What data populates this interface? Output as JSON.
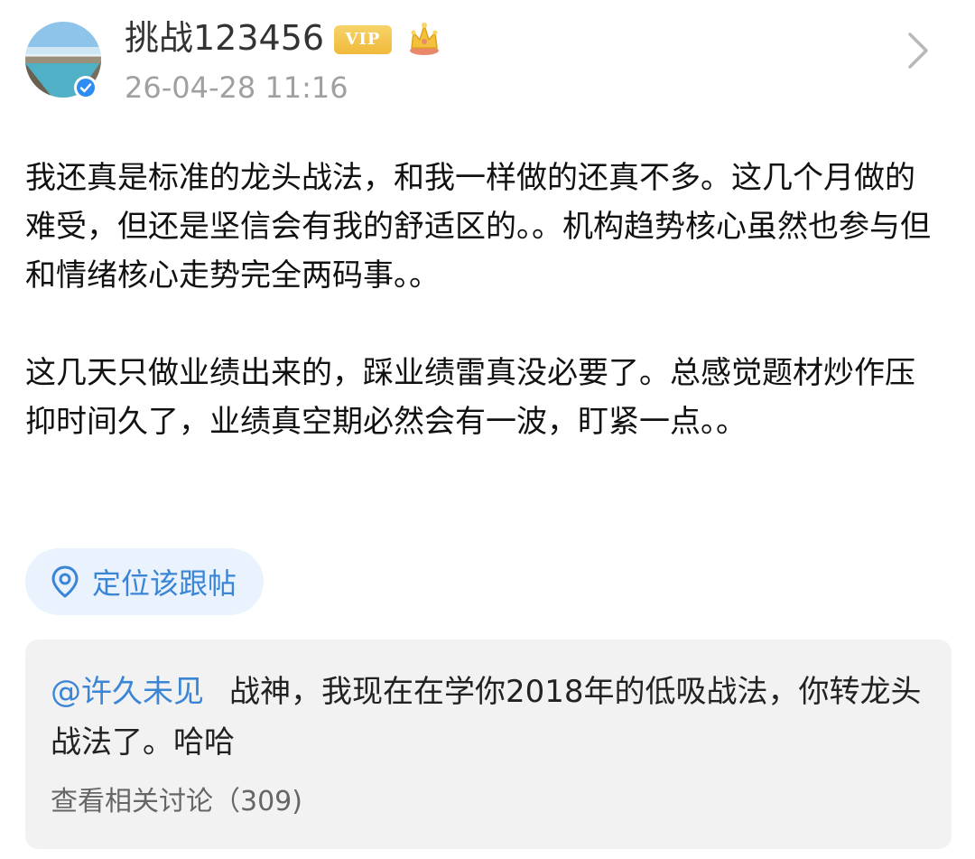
{
  "post": {
    "author": {
      "username": "挑战123456",
      "vip_label": "VIP",
      "avatar_icon": "lake-landscape-avatar",
      "verified_icon": "verified-check-icon",
      "crown_icon": "crown-icon"
    },
    "timestamp": "26-04-28 11:16",
    "body": {
      "paragraph_1": "我还真是标准的龙头战法，和我一样做的还真不多。这几个月做的难受，但还是坚信会有我的舒适区的。。机构趋势核心虽然也参与但和情绪核心走势完全两码事。。",
      "paragraph_2": "这几天只做业绩出来的，踩业绩雷真没必要了。总感觉题材炒作压抑时间久了，业绩真空期必然会有一波，盯紧一点。。"
    },
    "locate_button": {
      "label": "定位该跟帖",
      "icon": "location-pin-icon"
    },
    "quoted_reply": {
      "mention": "@许久未见",
      "text": "战神，我现在在学你2018年的低吸战法，你转龙头战法了。哈哈",
      "discussion_link": "查看相关讨论（309)"
    }
  },
  "colors": {
    "accent_blue": "#3a85d6",
    "vip_gold": "#f0b93a",
    "timestamp_gray": "#a0a0a0",
    "quote_bg": "#f2f2f2",
    "locate_bg": "#eaf3fd"
  }
}
